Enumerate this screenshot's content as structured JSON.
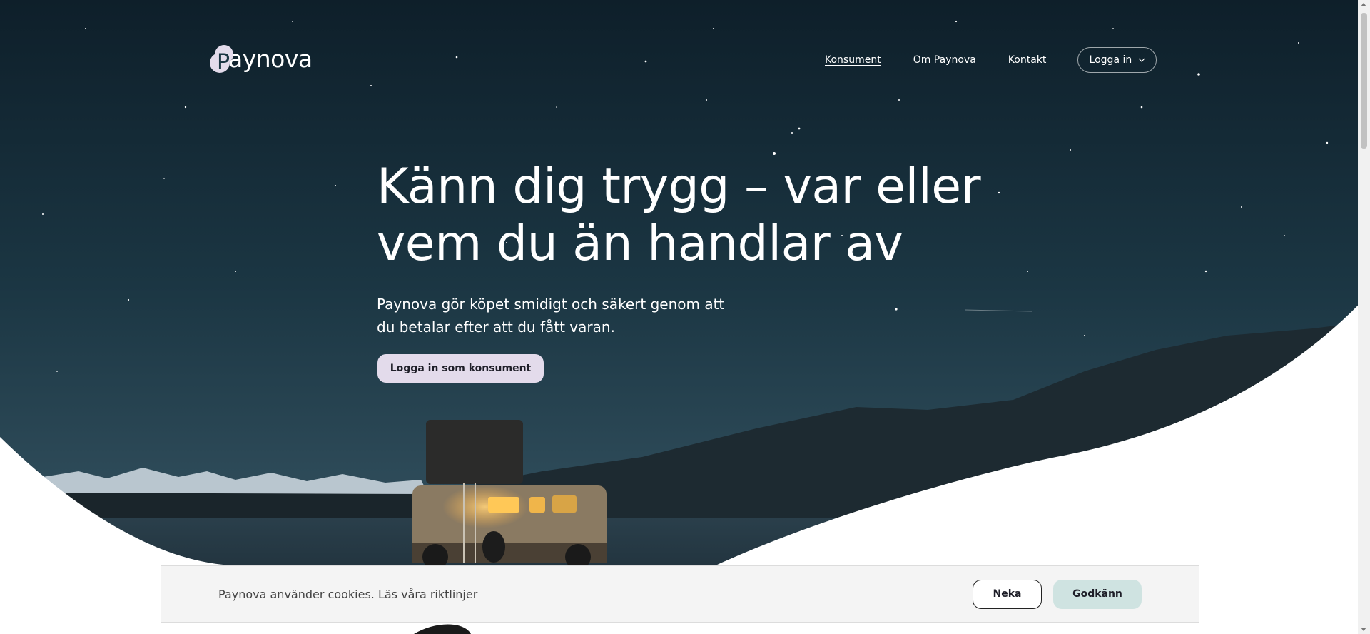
{
  "brand": {
    "name": "aynova",
    "logo_initial": "P"
  },
  "nav": {
    "items": [
      {
        "label": "Konsument",
        "active": true
      },
      {
        "label": "Om Paynova",
        "active": false
      },
      {
        "label": "Kontakt",
        "active": false
      }
    ],
    "login_label": "Logga in"
  },
  "hero": {
    "headline_line1": "Känn dig trygg – var eller",
    "headline_line2": "vem du än handlar av",
    "subline_line1": "Paynova gör köpet smidigt och säkert genom att",
    "subline_line2": "du betalar efter att du fått varan.",
    "cta_label": "Logga in som konsument"
  },
  "cookie_banner": {
    "text": "Paynova använder cookies. Läs våra riktlinjer",
    "deny_label": "Neka",
    "accept_label": "Godkänn"
  },
  "colors": {
    "sky_top": "#10232f",
    "sky_mid": "#1f3c4a",
    "cta_bg": "#e3dbeb",
    "accept_bg": "#cfe3e1"
  }
}
